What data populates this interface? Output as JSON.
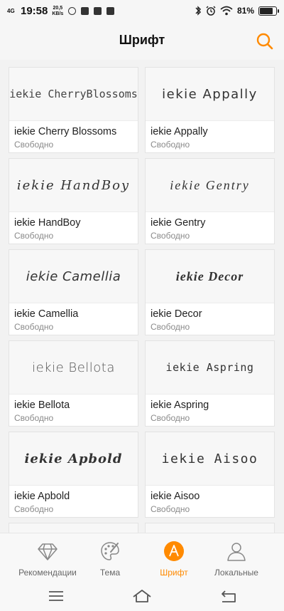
{
  "status_bar": {
    "network": "4G",
    "time": "19:58",
    "speed_value": "20,5",
    "speed_unit": "KB/s",
    "battery_text": "81%",
    "battery_level": 0.81,
    "icons": [
      "whatsapp-icon",
      "notification-icon",
      "notification-icon",
      "notification-icon",
      "bluetooth-icon",
      "alarm-icon",
      "wifi-icon"
    ]
  },
  "header": {
    "title": "Шрифт",
    "search_icon": "search-icon",
    "accent": "#ff8a00"
  },
  "fonts": [
    {
      "preview": "iekie CherryBlossoms",
      "name": "iekie Cherry Blossoms",
      "status": "Свободно"
    },
    {
      "preview": "iekie Appally",
      "name": "iekie Appally",
      "status": "Свободно"
    },
    {
      "preview": "iekie HandBoy",
      "name": "iekie HandBoy",
      "status": "Свободно"
    },
    {
      "preview": "iekie Gentry",
      "name": "iekie Gentry",
      "status": "Свободно"
    },
    {
      "preview": "iekie Camellia",
      "name": "iekie Camellia",
      "status": "Свободно"
    },
    {
      "preview": "iekie Decor",
      "name": "iekie Decor",
      "status": "Свободно"
    },
    {
      "preview": "iekie Bellota",
      "name": "iekie Bellota",
      "status": "Свободно"
    },
    {
      "preview": "iekie Aspring",
      "name": "iekie Aspring",
      "status": "Свободно"
    },
    {
      "preview": "iekie Apbold",
      "name": "iekie Apbold",
      "status": "Свободно"
    },
    {
      "preview": "iekie Aisoo",
      "name": "iekie Aisoo",
      "status": "Свободно"
    }
  ],
  "tabs": [
    {
      "label": "Рекомендации",
      "icon": "diamond-icon",
      "active": false
    },
    {
      "label": "Тема",
      "icon": "palette-icon",
      "active": false
    },
    {
      "label": "Шрифт",
      "icon": "font-icon",
      "active": true
    },
    {
      "label": "Локальные",
      "icon": "user-icon",
      "active": false
    }
  ],
  "nav": [
    "menu-icon",
    "home-icon",
    "back-icon"
  ]
}
